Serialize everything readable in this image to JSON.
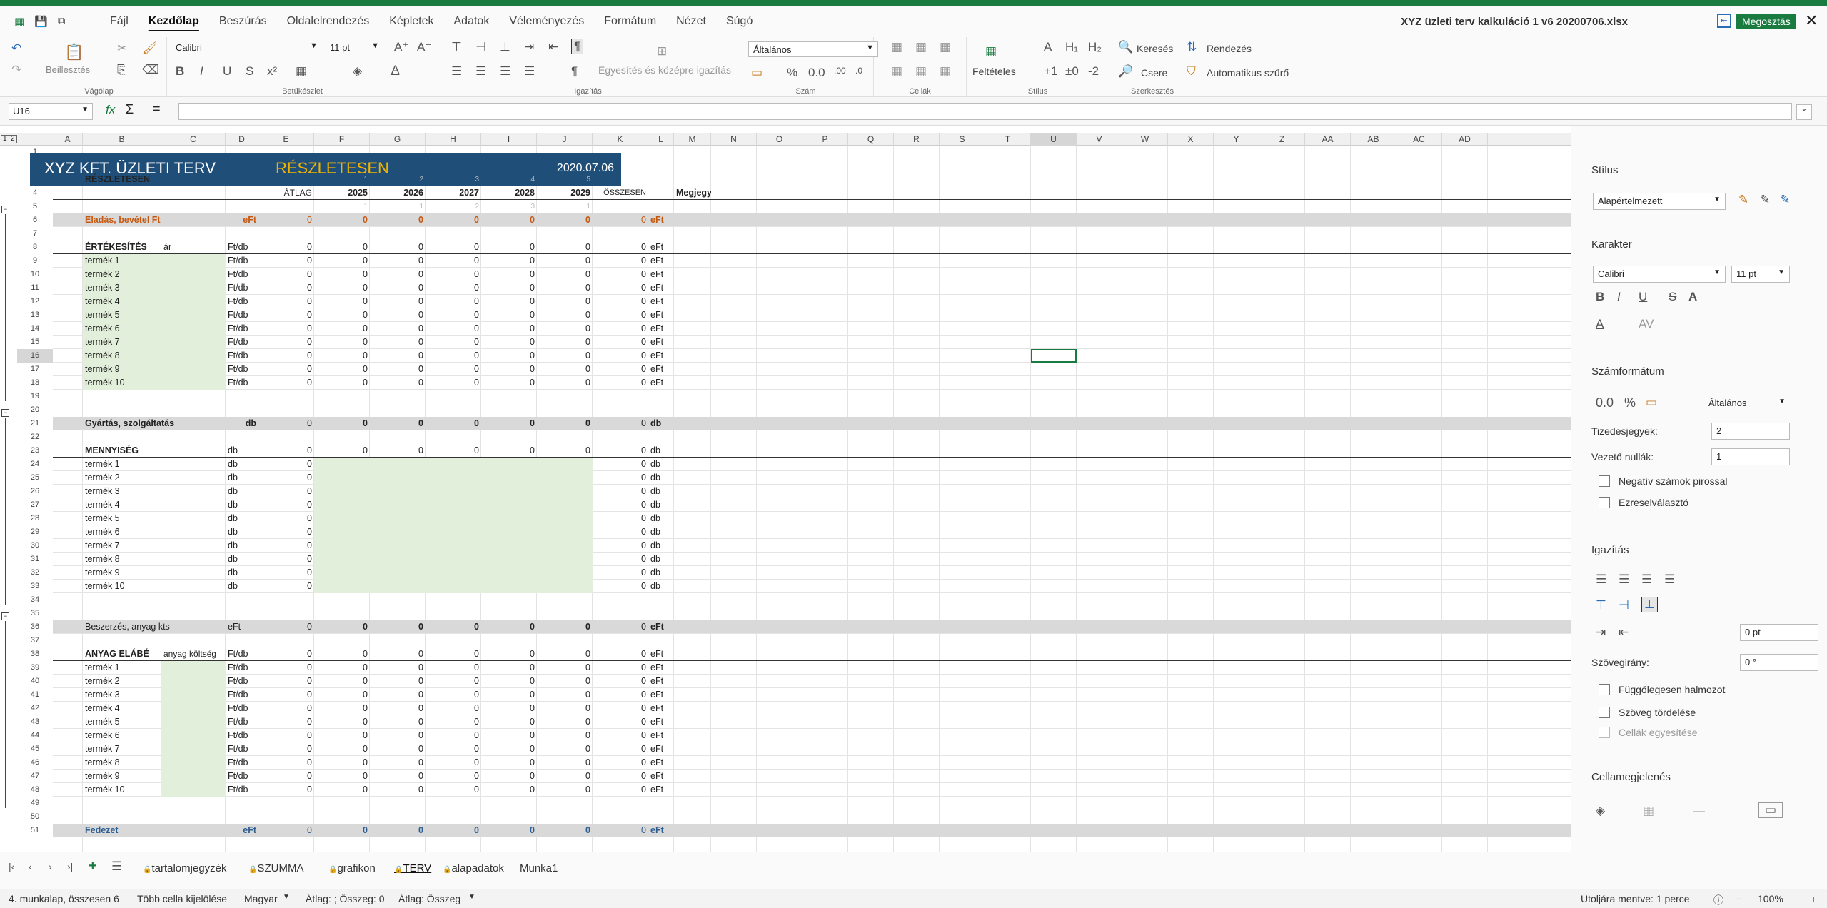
{
  "app": {
    "doc_title": "XYZ üzleti terv kalkuláció 1 v6 20200706.xlsx",
    "share_label": "Megosztás"
  },
  "menu": {
    "tabs": [
      "Fájl",
      "Kezdőlap",
      "Beszúrás",
      "Oldalelrendezés",
      "Képletek",
      "Adatok",
      "Véleményezés",
      "Formátum",
      "Nézet",
      "Súgó"
    ],
    "active_tab": "Kezdőlap"
  },
  "ribbon": {
    "paste_label": "Beillesztés",
    "group_clipboard": "Vágólap",
    "font_name": "Calibri",
    "font_size": "11 pt",
    "group_font": "Betűkészlet",
    "merge_label": "Egyesítés és középre igazítás",
    "group_alignment": "Igazítás",
    "number_format": "Általános",
    "group_number": "Szám",
    "group_cells": "Cellák",
    "conditional_label": "Feltételes",
    "group_style": "Stílus",
    "find_label": "Keresés",
    "replace_label": "Csere",
    "sort_label": "Rendezés",
    "autofilter_label": "Automatikus szűrő",
    "group_editing": "Szerkesztés"
  },
  "formula_bar": {
    "name_box": "U16",
    "fx": "fx",
    "sigma": "Σ",
    "equals": "="
  },
  "columns": [
    "A",
    "B",
    "C",
    "D",
    "E",
    "F",
    "G",
    "H",
    "I",
    "J",
    "K",
    "L",
    "M",
    "N",
    "O",
    "P",
    "Q",
    "R",
    "S",
    "T",
    "U",
    "V",
    "W",
    "X",
    "Y",
    "Z",
    "AA",
    "AB",
    "AC",
    "AD"
  ],
  "sheet": {
    "title": "XYZ KFT.  ÜZLETI TERV",
    "subtitle": "RÉSZLETESEN",
    "date": "2020.07.06",
    "section_label": "RÉSZLETESEN",
    "year_idx": [
      "1",
      "2",
      "3",
      "4",
      "5"
    ],
    "year_idx2": [
      "1",
      "1",
      "2",
      "3",
      "1"
    ],
    "header": {
      "avg": "ÁTLAG",
      "years": [
        "2025",
        "2026",
        "2027",
        "2028",
        "2029"
      ],
      "total": "ÖSSZESEN",
      "note": "Megjegyzés"
    },
    "sales": {
      "label": "Eladás, bevétel Ft",
      "unit": "eFt",
      "avg": "0",
      "vals": [
        "0",
        "0",
        "0",
        "0",
        "0"
      ],
      "total": "0",
      "unit2": "eFt"
    },
    "sales_block": {
      "label": "ÉRTÉKESÍTÉS",
      "col_c": "ár",
      "unit": "Ft/db",
      "avg": "0",
      "vals": [
        "0",
        "0",
        "0",
        "0",
        "0"
      ],
      "total": "0",
      "unit2": "eFt"
    },
    "products": [
      "termék 1",
      "termék 2",
      "termék 3",
      "termék 4",
      "termék 5",
      "termék 6",
      "termék 7",
      "termék 8",
      "termék 9",
      "termék 10"
    ],
    "zero": "0",
    "unit_ftdb": "Ft/db",
    "unit_eft": "eFt",
    "unit_db": "db",
    "production": {
      "label": "Gyártás, szolgáltatás",
      "unit": "db"
    },
    "quantity": {
      "label": "MENNYISÉG",
      "unit": "db"
    },
    "purchase": {
      "label": "Beszerzés, anyag kts",
      "unit": "eFt"
    },
    "material": {
      "label": "ANYAG ELÁBÉ",
      "col_c": "anyag költség",
      "unit": "Ft/db"
    },
    "margin": {
      "label": "Fedezet",
      "unit": "eFt"
    }
  },
  "sidebar": {
    "style_title": "Stílus",
    "style_value": "Alapértelmezett",
    "char_title": "Karakter",
    "font_name": "Calibri",
    "font_size": "11 pt",
    "number_title": "Számformátum",
    "number_value": "Általános",
    "decimals_label": "Tizedesjegyek:",
    "decimals_value": "2",
    "leading_label": "Vezető nullák:",
    "leading_value": "1",
    "neg_red": "Negatív számok pirossal",
    "thousands": "Ezreselválasztó",
    "align_title": "Igazítás",
    "indent_value": "0 pt",
    "text_dir_label": "Szövegirány:",
    "text_dir_value": "0 °",
    "vertical_stack": "Függőlegesen halmozot",
    "wrap_text": "Szöveg tördelése",
    "merge_cells": "Cellák egyesítése",
    "cell_appearance": "Cellamegjelenés"
  },
  "sheet_tabs": [
    "tartalomjegyzék",
    "SZUMMA",
    "grafikon",
    "TERV",
    "alapadatok",
    "Munka1"
  ],
  "active_sheet": "TERV",
  "status": {
    "sheet_info": "4. munkalap, összesen 6",
    "selection": "Több cella kijelölése",
    "language": "Magyar",
    "stats1": "Átlag: ; Összeg: 0",
    "stats2": "Átlag: Összeg",
    "saved": "Utoljára mentve: 1 perce",
    "zoom": "100%"
  },
  "colors": {
    "accent": "#1a7b40",
    "title_bar": "#1f4e79",
    "subtitle": "#f0b400",
    "orange_text": "#c65911",
    "blue_text": "#2e5d91",
    "input_fill": "#e2efda",
    "band": "#d9d9d9"
  }
}
